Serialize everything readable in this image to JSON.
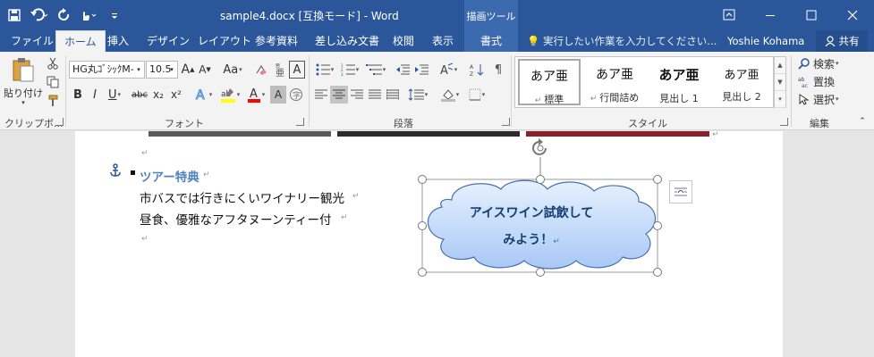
{
  "titlebar": {
    "doc_title": "sample4.docx [互換モード] - Word",
    "context_group": "描画ツール",
    "accent": "#2b579a"
  },
  "quick_access": {
    "icons": [
      "save-icon",
      "undo-icon",
      "redo-icon",
      "touch-mode-icon",
      "customize-icon"
    ]
  },
  "window_controls": {
    "icons": [
      "ribbon-display-options-icon",
      "minimize-icon",
      "maximize-icon",
      "close-icon"
    ]
  },
  "tabs": [
    {
      "label": "ファイル"
    },
    {
      "label": "ホーム"
    },
    {
      "label": "挿入"
    },
    {
      "label": "デザイン"
    },
    {
      "label": "レイアウト"
    },
    {
      "label": "参考資料"
    },
    {
      "label": "差し込み文書"
    },
    {
      "label": "校閲"
    },
    {
      "label": "表示"
    },
    {
      "label": "書式"
    }
  ],
  "active_tab": "ホーム",
  "tellme": {
    "label": "実行したい作業を入力してください..."
  },
  "user": {
    "name": "Yoshie Kohama"
  },
  "share": {
    "label": "共有"
  },
  "ribbon": {
    "clipboard": {
      "paste": "貼り付け",
      "group": "クリップボ..."
    },
    "font": {
      "name": "HG丸ｺﾞｼｯｸM-",
      "size": "10.5",
      "change_case": "Aa",
      "bold": "B",
      "italic": "I",
      "underline": "U",
      "strikethrough": "abc",
      "subscript": "x₂",
      "superscript": "x²",
      "grow": "A",
      "shrink": "A",
      "highlight_color": "#ffff00",
      "font_color": "#ff0000",
      "group": "フォント"
    },
    "paragraph": {
      "group": "段落"
    },
    "styles": {
      "items": [
        {
          "sample": "あア亜",
          "name": "標準"
        },
        {
          "sample": "あア亜",
          "name": "行間詰め"
        },
        {
          "sample": "あア亜",
          "name": "見出し 1"
        },
        {
          "sample": "あア亜",
          "name": "見出し 2"
        }
      ],
      "group": "スタイル"
    },
    "editing": {
      "find": "検索",
      "replace": "置換",
      "select": "選択",
      "group": "編集"
    }
  },
  "document": {
    "heading": "ツアー特典",
    "lines": [
      "市バスでは行きにくいワイナリー観光",
      "昼食、優雅なアフタヌーンティー付"
    ],
    "callout_lines": [
      "アイスワイン試飲して",
      "みよう！"
    ],
    "heading_color": "#4f81bd",
    "callout_fill": "#a9c8f5"
  }
}
